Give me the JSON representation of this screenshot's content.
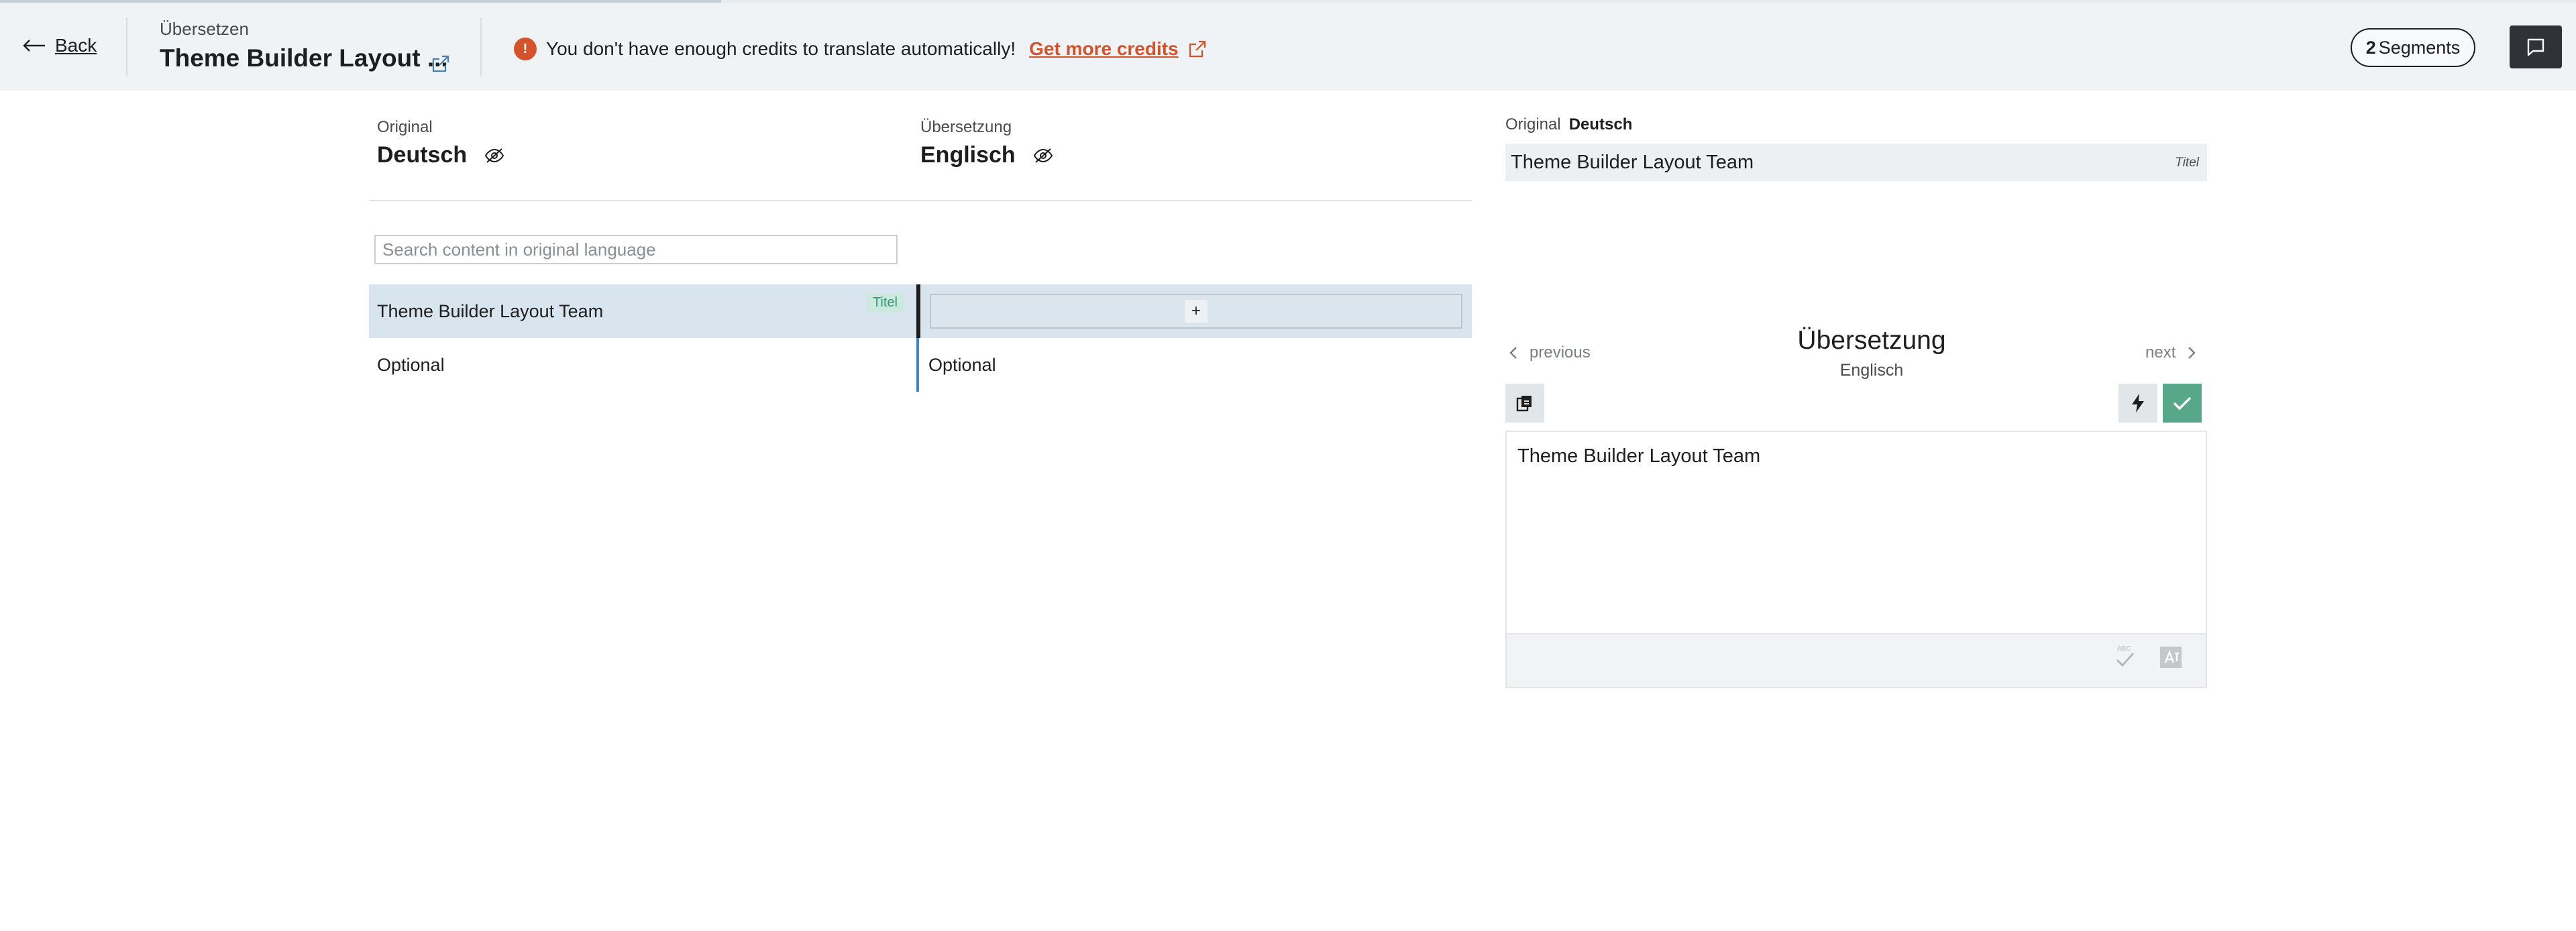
{
  "header": {
    "back_label": "Back",
    "breadcrumb": "Übersetzen",
    "title": "Theme Builder Layout ...",
    "warning_text": "You don't have enough credits to translate automatically!",
    "warning_icon": "!",
    "get_credits_label": "Get more credits",
    "segments_count": "2",
    "segments_label": "Segments"
  },
  "languages": {
    "original_label": "Original",
    "original_lang": "Deutsch",
    "translation_label": "Übersetzung",
    "translation_lang": "Englisch"
  },
  "search": {
    "placeholder": "Search content in original language"
  },
  "rows": [
    {
      "original": "Theme Builder Layout Team",
      "tag": "Titel",
      "translation": ""
    },
    {
      "original": "Optional",
      "tag": "",
      "translation": "Optional"
    }
  ],
  "add_label": "+",
  "panel": {
    "original_label": "Original",
    "original_lang": "Deutsch",
    "original_text": "Theme Builder Layout Team",
    "original_tag": "Titel",
    "previous_label": "previous",
    "next_label": "next",
    "title": "Übersetzung",
    "subtitle": "Englisch",
    "editor_text": "Theme Builder Layout Team"
  },
  "colors": {
    "warning": "#d4532b",
    "accept": "#57a88a",
    "active_row": "#d8e4ee",
    "header_bg": "#f0f3f5"
  },
  "progress": 0.28
}
